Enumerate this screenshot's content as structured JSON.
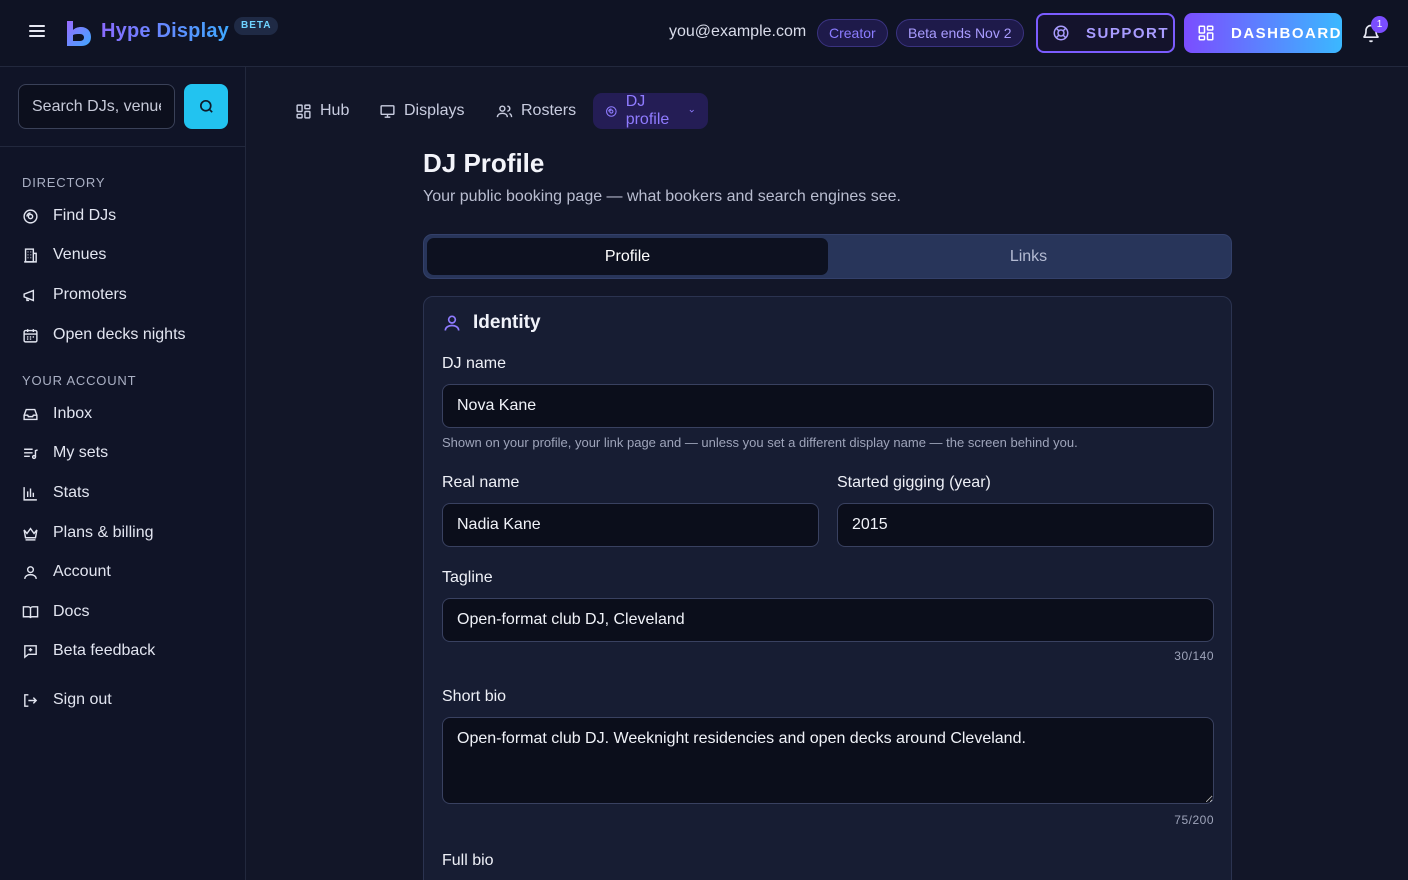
{
  "header": {
    "brand": "Hype Display",
    "beta_badge": "BETA",
    "email": "you@example.com",
    "plan_badge": "Creator",
    "beta_notice": "Beta ends Nov 2",
    "support_label": "SUPPORT",
    "dashboard_label": "DASHBOARD",
    "notification_count": "1"
  },
  "sidebar": {
    "search_placeholder": "Search DJs, venues",
    "directory_title": "DIRECTORY",
    "directory_items": [
      "Find DJs",
      "Venues",
      "Promoters",
      "Open decks nights"
    ],
    "account_title": "YOUR ACCOUNT",
    "account_items": [
      "Inbox",
      "My sets",
      "Stats",
      "Plans & billing",
      "Account",
      "Docs",
      "Beta feedback"
    ],
    "sign_out": "Sign out"
  },
  "topnav": {
    "items": [
      "Hub",
      "Displays",
      "Rosters",
      "DJ profile"
    ],
    "active": "DJ profile"
  },
  "page": {
    "title": "DJ Profile",
    "subtitle": "Your public booking page — what bookers and search engines see."
  },
  "tabs": [
    "Profile",
    "Links"
  ],
  "identity": {
    "title": "Identity",
    "dj_name_label": "DJ name",
    "dj_name_value": "Nova Kane",
    "dj_name_hint": "Shown on your profile, your link page and — unless you set a different display name — the screen behind you.",
    "real_name_label": "Real name",
    "real_name_value": "Nadia Kane",
    "started_label": "Started gigging (year)",
    "started_value": "2015",
    "tagline_label": "Tagline",
    "tagline_value": "Open-format club DJ, Cleveland",
    "tagline_counter": "30/140",
    "short_bio_label": "Short bio",
    "short_bio_value": "Open-format club DJ. Weeknight residencies and open decks around Cleveland.",
    "short_bio_counter": "75/200",
    "full_bio_label": "Full bio"
  },
  "colors": {
    "accent": "#7b4dff",
    "cyan": "#22c3f0",
    "background": "#121628"
  }
}
